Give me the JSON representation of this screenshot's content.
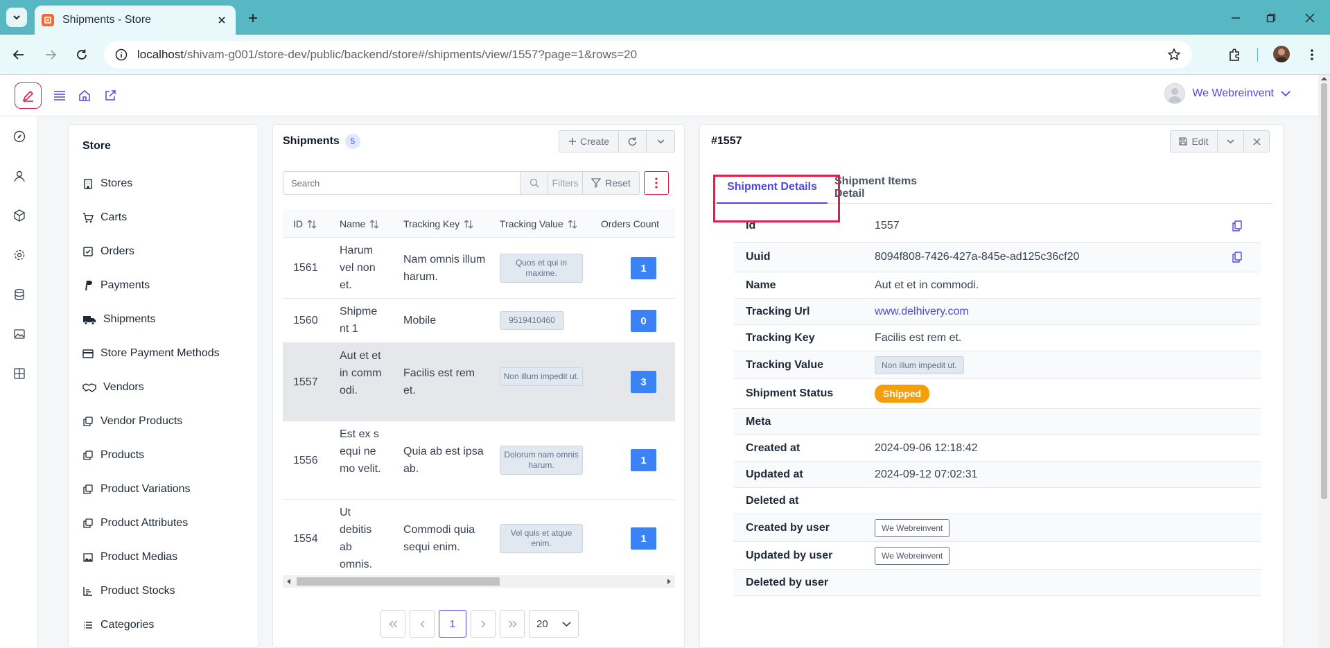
{
  "browser": {
    "tab_title": "Shipments - Store",
    "url_host": "localhost",
    "url_path": "/shivam-g001/store-dev/public/backend/store#/shipments/view/1557?page=1&rows=20"
  },
  "app": {
    "user_name": "We Webreinvent"
  },
  "sidebar": {
    "title": "Store",
    "items": [
      {
        "label": "Stores",
        "icon": "building-icon"
      },
      {
        "label": "Carts",
        "icon": "cart-icon"
      },
      {
        "label": "Orders",
        "icon": "check-square-icon"
      },
      {
        "label": "Payments",
        "icon": "paypal-icon"
      },
      {
        "label": "Shipments",
        "icon": "truck-icon"
      },
      {
        "label": "Store Payment Methods",
        "icon": "credit-card-icon"
      },
      {
        "label": "Vendors",
        "icon": "handshake-icon"
      },
      {
        "label": "Vendor Products",
        "icon": "copy-icon"
      },
      {
        "label": "Products",
        "icon": "copy-icon"
      },
      {
        "label": "Product Variations",
        "icon": "copy-icon"
      },
      {
        "label": "Product Attributes",
        "icon": "copy-icon"
      },
      {
        "label": "Product Medias",
        "icon": "image-icon"
      },
      {
        "label": "Product Stocks",
        "icon": "chart-icon"
      },
      {
        "label": "Categories",
        "icon": "list-icon"
      }
    ]
  },
  "list": {
    "title": "Shipments",
    "count": "5",
    "create_label": "Create",
    "search_placeholder": "Search",
    "filters_label": "Filters",
    "reset_label": "Reset",
    "columns": [
      "ID",
      "Name",
      "Tracking Key",
      "Tracking Value",
      "Orders Count"
    ],
    "rows": [
      {
        "id": "1561",
        "name": "Harum vel non et.",
        "key": "Nam omnis illum harum.",
        "value": "Quos et qui in maxime.",
        "count": "1"
      },
      {
        "id": "1560",
        "name": "Shipment 1",
        "key": "Mobile",
        "value": "9519410460",
        "count": "0"
      },
      {
        "id": "1557",
        "name": "Aut et et in commodi.",
        "key": "Facilis est rem et.",
        "value": "Non illum impedit ut.",
        "count": "3"
      },
      {
        "id": "1556",
        "name": "Est ex sequi nemo velit.",
        "key": "Quia ab est ipsa ab.",
        "value": "Dolorum nam omnis harum.",
        "count": "1"
      },
      {
        "id": "1554",
        "name": "Ut debitis ab omnis.",
        "key": "Commodi quia sequi enim.",
        "value": "Vel quis et atque enim.",
        "count": "1"
      }
    ],
    "pagination": {
      "current_page": "1",
      "rows_per_page": "20"
    }
  },
  "detail": {
    "title": "#1557",
    "edit_label": "Edit",
    "tabs": [
      "Shipment Details",
      "Shipment Items Detail"
    ],
    "fields": {
      "id": {
        "label": "Id",
        "value": "1557"
      },
      "uuid": {
        "label": "Uuid",
        "value": "8094f808-7426-427a-845e-ad125c36cf20"
      },
      "name": {
        "label": "Name",
        "value": "Aut et et in commodi."
      },
      "tracking_url": {
        "label": "Tracking Url",
        "value": "www.delhivery.com"
      },
      "tracking_key": {
        "label": "Tracking Key",
        "value": "Facilis est rem et."
      },
      "tracking_value": {
        "label": "Tracking Value",
        "value": "Non illum impedit ut."
      },
      "status": {
        "label": "Shipment Status",
        "value": "Shipped"
      },
      "meta": {
        "label": "Meta",
        "value": ""
      },
      "created_at": {
        "label": "Created at",
        "value": "2024-09-06 12:18:42"
      },
      "updated_at": {
        "label": "Updated at",
        "value": "2024-09-12 07:02:31"
      },
      "deleted_at": {
        "label": "Deleted at",
        "value": ""
      },
      "created_by": {
        "label": "Created by user",
        "value": "We Webreinvent"
      },
      "updated_by": {
        "label": "Updated by user",
        "value": "We Webreinvent"
      },
      "deleted_by": {
        "label": "Deleted by user",
        "value": ""
      }
    }
  },
  "colors": {
    "accent": "#4f46e5",
    "count_badge": "#3b82f6",
    "status_shipped": "#f59e0b",
    "highlight": "#e11d48"
  }
}
